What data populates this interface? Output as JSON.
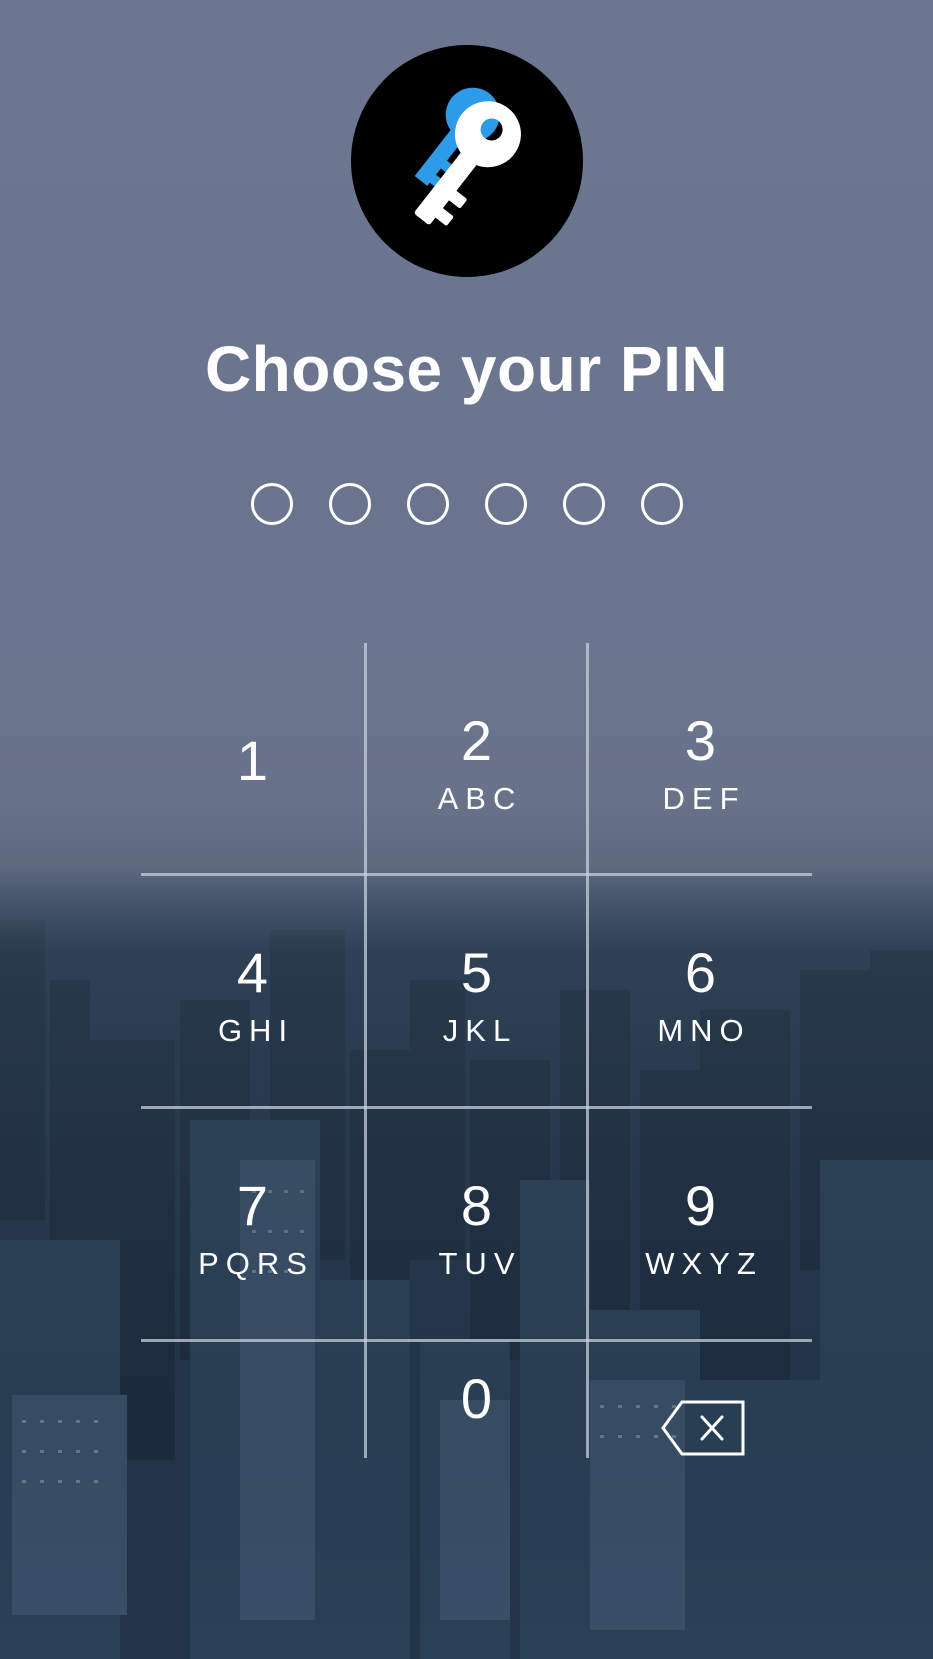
{
  "title": "Choose your PIN",
  "pin": {
    "length": 6,
    "filled": 0
  },
  "keys": [
    {
      "num": "1",
      "letters": ""
    },
    {
      "num": "2",
      "letters": "ABC"
    },
    {
      "num": "3",
      "letters": "DEF"
    },
    {
      "num": "4",
      "letters": "GHI"
    },
    {
      "num": "5",
      "letters": "JKL"
    },
    {
      "num": "6",
      "letters": "MNO"
    },
    {
      "num": "7",
      "letters": "PQRS"
    },
    {
      "num": "8",
      "letters": "TUV"
    },
    {
      "num": "9",
      "letters": "WXYZ"
    },
    {
      "num": "0",
      "letters": ""
    }
  ],
  "icons": {
    "logo": "key-icon",
    "backspace": "backspace-icon",
    "pin_slot": "circle-outline"
  },
  "colors": {
    "logo_background": "#000000",
    "key_white": "#ffffff",
    "key_blue": "#2e9be8",
    "text": "#ffffff"
  }
}
